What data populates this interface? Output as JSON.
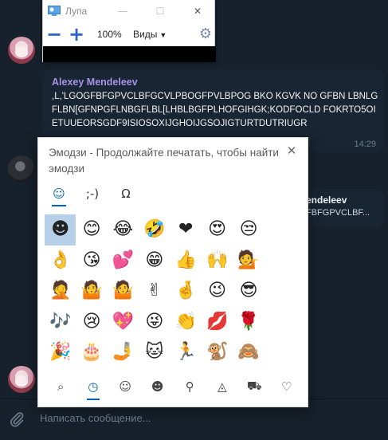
{
  "magnifier": {
    "title": "Лупа",
    "zoom_out": "−",
    "zoom_in": "+",
    "zoom_level": "100%",
    "views_label": "Виды",
    "minimize": "—",
    "maximize": "☐",
    "close": "✕",
    "settings": "⚙"
  },
  "chat": {
    "message": {
      "sender": "Alexey Mendeleev",
      "text": ",L,'LGOGFBFGPVCLBFGCVLPBOGFPVLBPOG BKO KGVK NO GFBN LBNLGFLBN[GFNPGFLNBGFLBL[LHBLBGFPLHOFGIHGK;KODFOCLD FOKRTO5OIETUUEORSGDF9ISIOSOXIJGHOIJGSOJIGTURTDUTRIUGR",
      "time": "14:29"
    },
    "reply": {
      "name": "endeleev",
      "text": "FBFGPVCLBF..."
    },
    "composer_placeholder": "Написать сообщение..."
  },
  "emoji_panel": {
    "title": "Эмодзи - Продолжайте печатать, чтобы найти эмодзи",
    "close": "✕",
    "tabs": [
      {
        "label": "☺",
        "name": "tab-emoji",
        "active": true
      },
      {
        "label": ";-)",
        "name": "tab-kaomoji",
        "active": false
      },
      {
        "label": "Ω",
        "name": "tab-symbols",
        "active": false
      }
    ],
    "emojis": [
      "☻",
      "😊",
      "😂",
      "🤣",
      "❤",
      "😍",
      "😒",
      "👌",
      "😘",
      "💕",
      "😁",
      "👍",
      "🙌",
      "💁",
      "🤦",
      "🤷",
      "🤷",
      "✌",
      "🤞",
      "😉",
      "😎",
      "🎶",
      "😢",
      "💖",
      "😜",
      "👏",
      "💋",
      "🌹",
      "🎉",
      "🎂",
      "🤳",
      "🐱",
      "🏃",
      "🐒",
      "🙈",
      "🙊",
      "🙉",
      "✔",
      "👀",
      "😐"
    ],
    "footer": [
      {
        "label": "⌕",
        "name": "search-category-icon"
      },
      {
        "label": "◷",
        "name": "recent-category-icon",
        "active": true
      },
      {
        "label": "☺",
        "name": "smiley-category-icon"
      },
      {
        "label": "☻",
        "name": "people-category-icon"
      },
      {
        "label": "⚲",
        "name": "celebration-category-icon"
      },
      {
        "label": "◬",
        "name": "food-category-icon"
      },
      {
        "label": "⛟",
        "name": "travel-category-icon"
      },
      {
        "label": "♡",
        "name": "heart-category-icon"
      }
    ]
  }
}
